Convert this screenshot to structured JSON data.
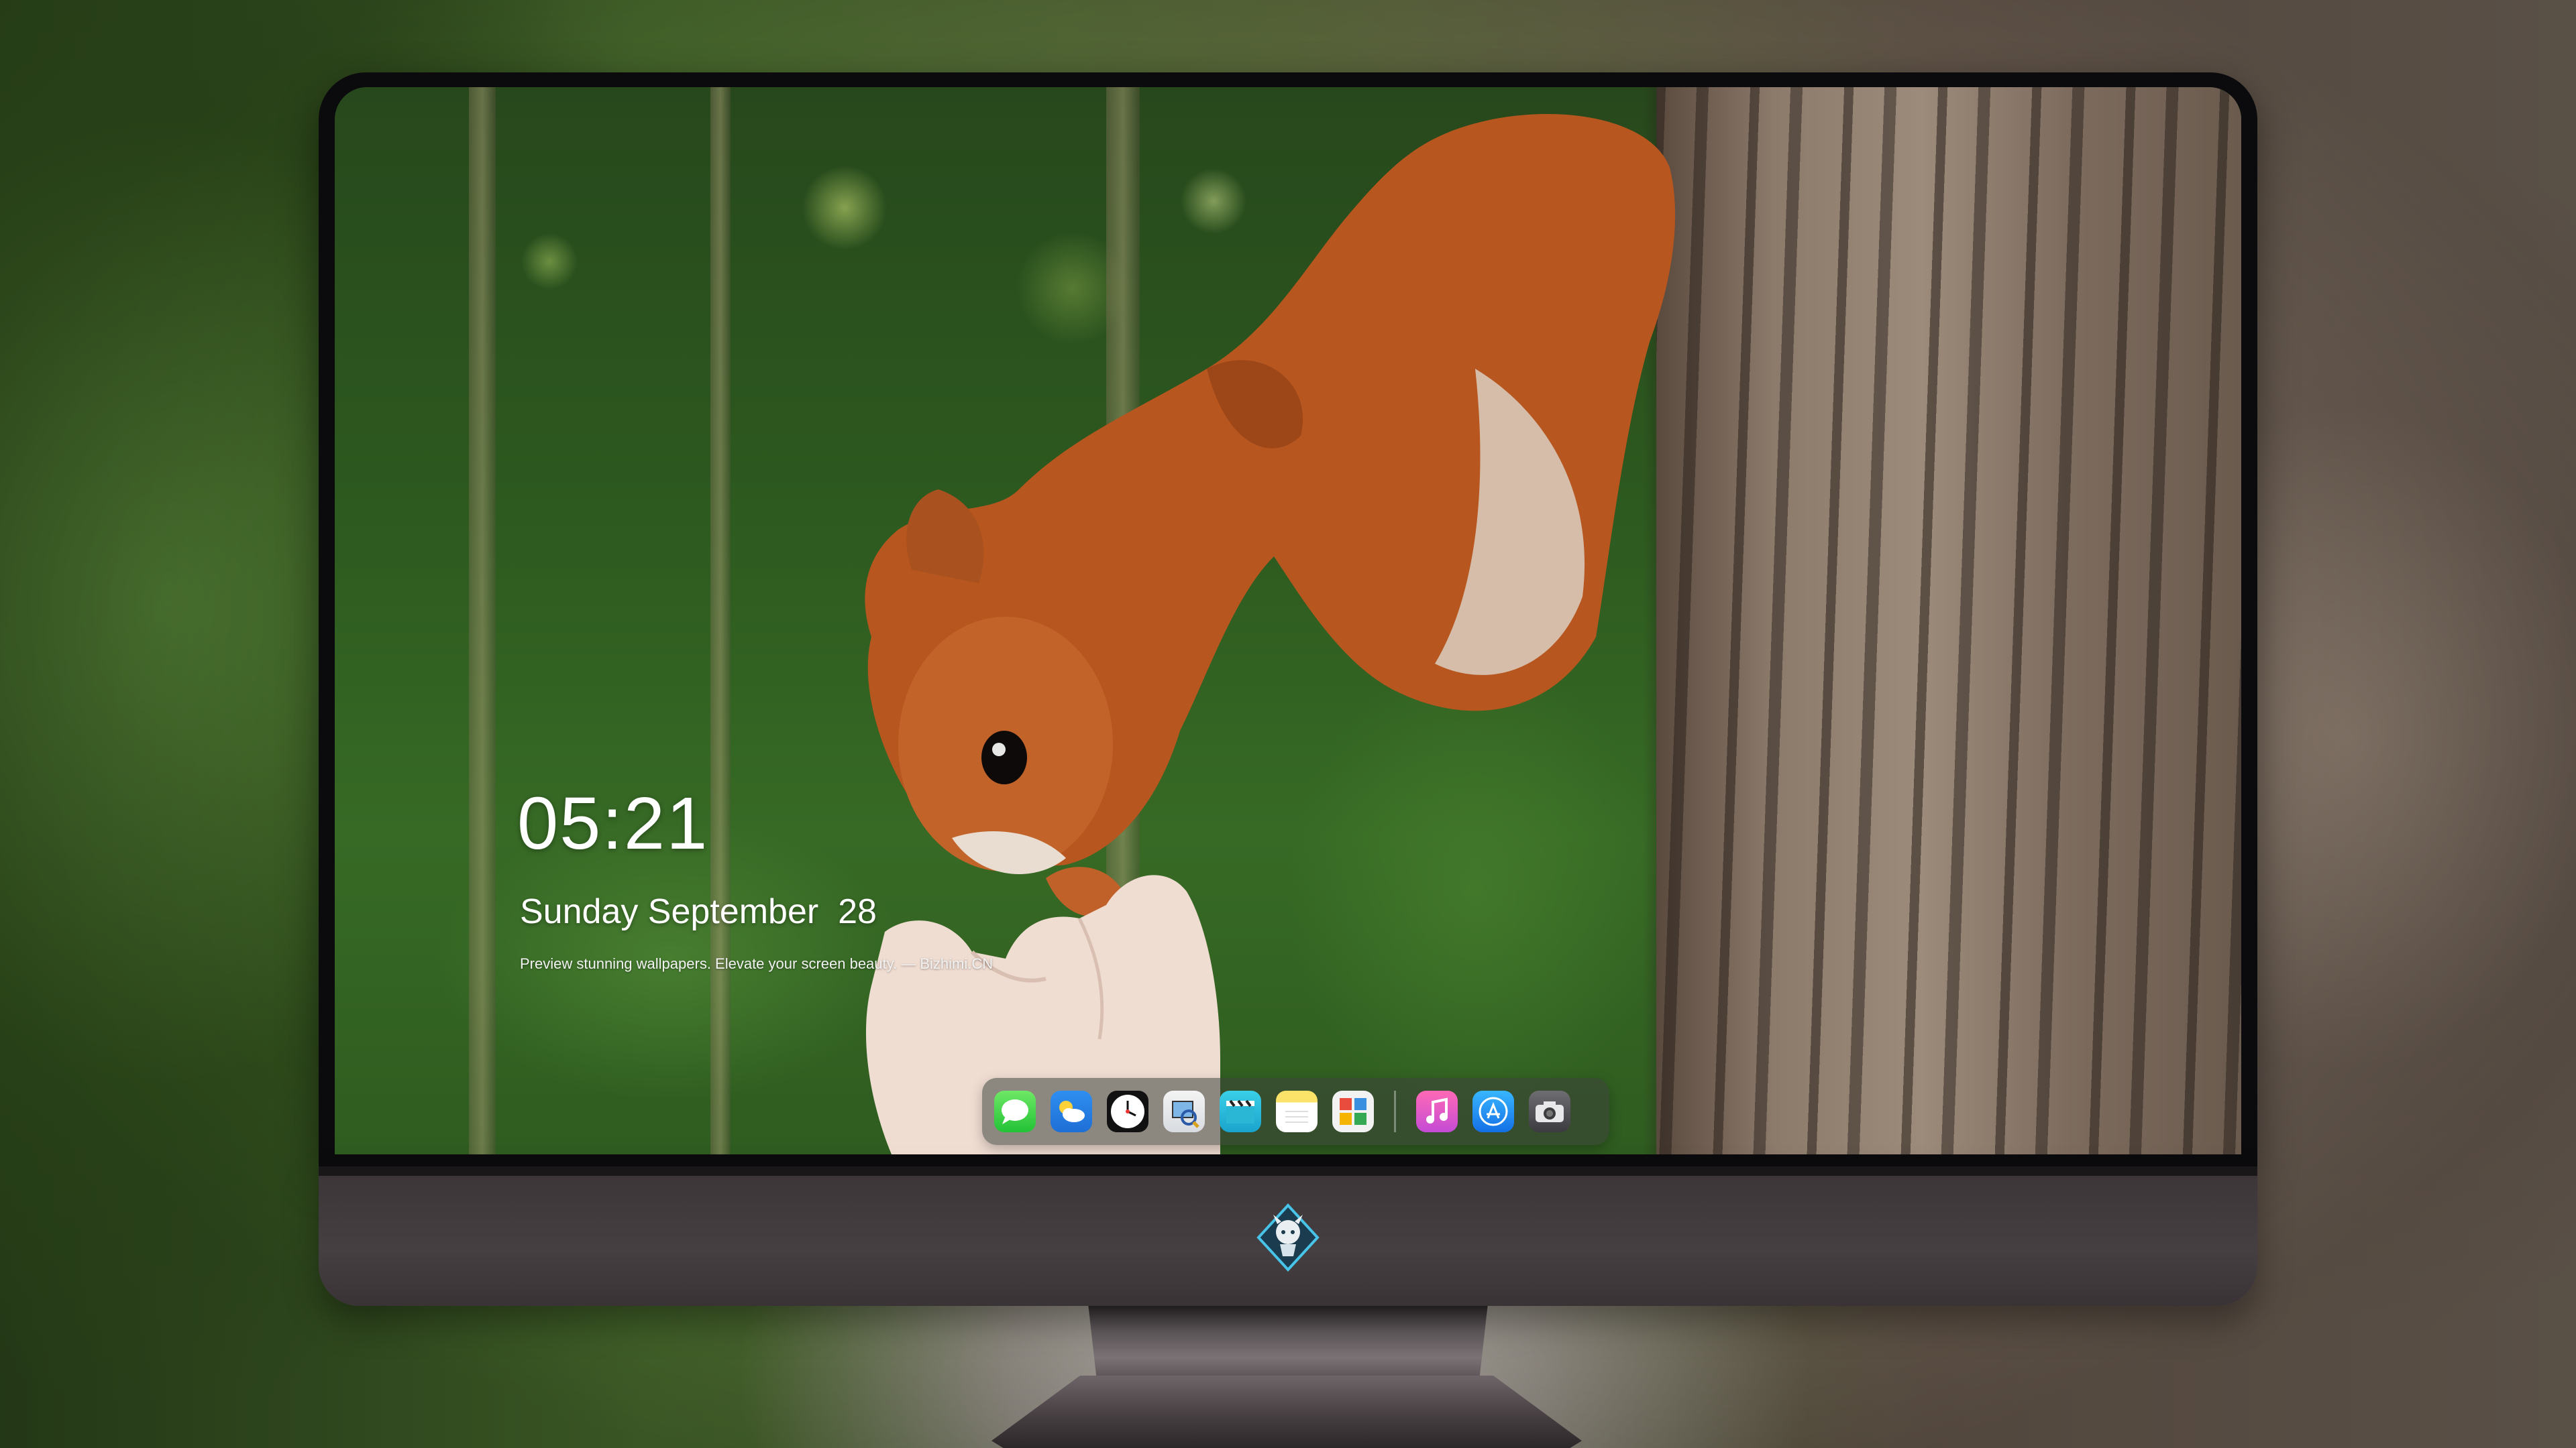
{
  "lock_screen": {
    "time": "05:21",
    "date": "Sunday September  28",
    "tagline": "Preview stunning wallpapers. Elevate your screen beauty. — Bizhimi.CN"
  },
  "dock": {
    "apps": [
      {
        "name": "messages",
        "icon": "messages-icon"
      },
      {
        "name": "weather",
        "icon": "weather-icon"
      },
      {
        "name": "clock",
        "icon": "clock-icon"
      },
      {
        "name": "preview",
        "icon": "preview-icon"
      },
      {
        "name": "clips",
        "icon": "clapperboard-icon"
      },
      {
        "name": "notes",
        "icon": "notes-icon"
      },
      {
        "name": "photo-booth",
        "icon": "photos-icon"
      },
      {
        "name": "music",
        "icon": "music-note-icon"
      },
      {
        "name": "app-store",
        "icon": "app-store-icon"
      },
      {
        "name": "camera",
        "icon": "camera-icon"
      }
    ]
  },
  "monitor": {
    "logo": "mascot-logo-icon"
  },
  "colors": {
    "bezel": "#0b0b0d",
    "chin": "#463f42",
    "text": "#ffffff"
  }
}
